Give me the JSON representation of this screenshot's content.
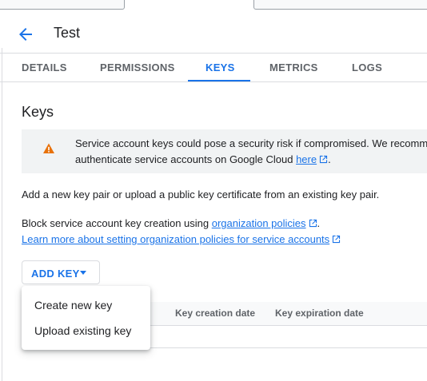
{
  "header": {
    "title": "Test",
    "back_icon": "arrow-back-icon"
  },
  "tabs": [
    {
      "label": "DETAILS"
    },
    {
      "label": "PERMISSIONS"
    },
    {
      "label": "KEYS",
      "active": true
    },
    {
      "label": "METRICS"
    },
    {
      "label": "LOGS"
    }
  ],
  "keys": {
    "title": "Keys",
    "warning": {
      "icon": "warning-icon",
      "line1": "Service account keys could pose a security risk if compromised. We recomm",
      "line2_prefix": "authenticate service accounts on Google Cloud ",
      "link": "here",
      "line2_suffix": "."
    },
    "description": "Add a new key pair or upload a public key certificate from an existing key pair.",
    "block_prefix": "Block service account key creation using ",
    "org_policies_link": "organization policies",
    "block_suffix": ".",
    "learn_more_link": "Learn more about setting organization policies for service accounts",
    "add_key_label": "ADD KEY",
    "table_headers": [
      "Key creation date",
      "Key expiration date"
    ],
    "menu_items": [
      "Create new key",
      "Upload existing key"
    ]
  },
  "colors": {
    "accent": "#1a73e8",
    "warning": "#e8710a"
  }
}
